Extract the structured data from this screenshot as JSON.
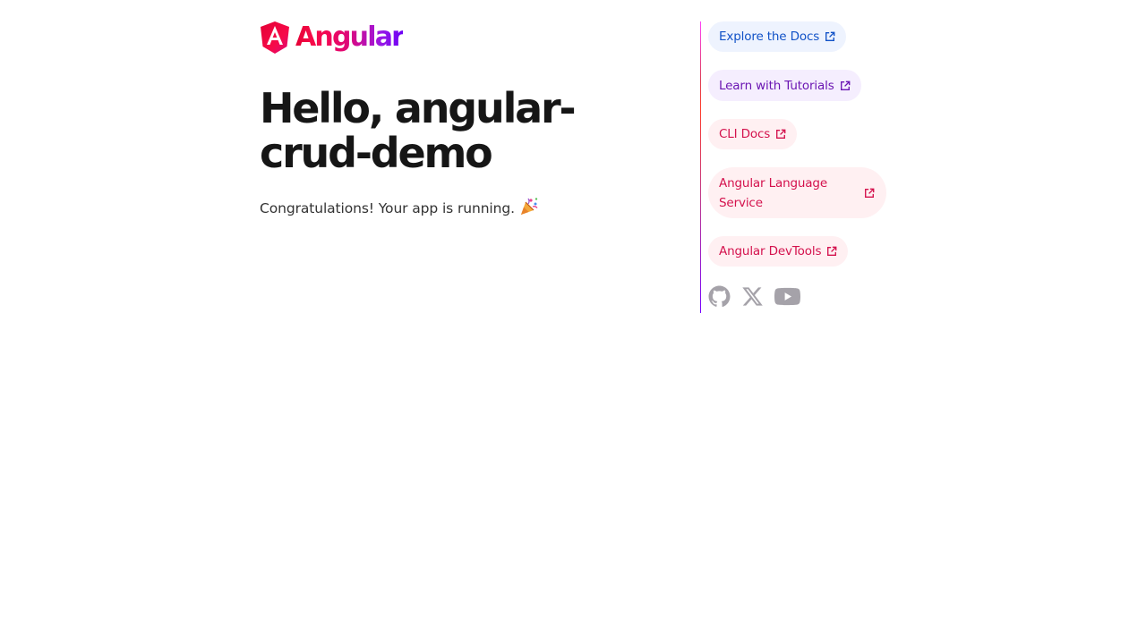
{
  "brand": {
    "name": "Angular"
  },
  "hero": {
    "title": "Hello, angular-crud-demo",
    "subtitle": "Congratulations! Your app is running.",
    "emoji": "🎉"
  },
  "links": [
    {
      "label": "Explore the Docs"
    },
    {
      "label": "Learn with Tutorials"
    },
    {
      "label": "CLI Docs"
    },
    {
      "label": "Angular Language Service"
    },
    {
      "label": "Angular DevTools"
    }
  ],
  "social": {
    "icons": [
      "github-icon",
      "x-icon",
      "youtube-icon"
    ],
    "color": "#a5a2a9"
  },
  "colors": {
    "text": "#161616",
    "divider_top": "#dd3d56",
    "divider_bottom": "#7702ff"
  }
}
